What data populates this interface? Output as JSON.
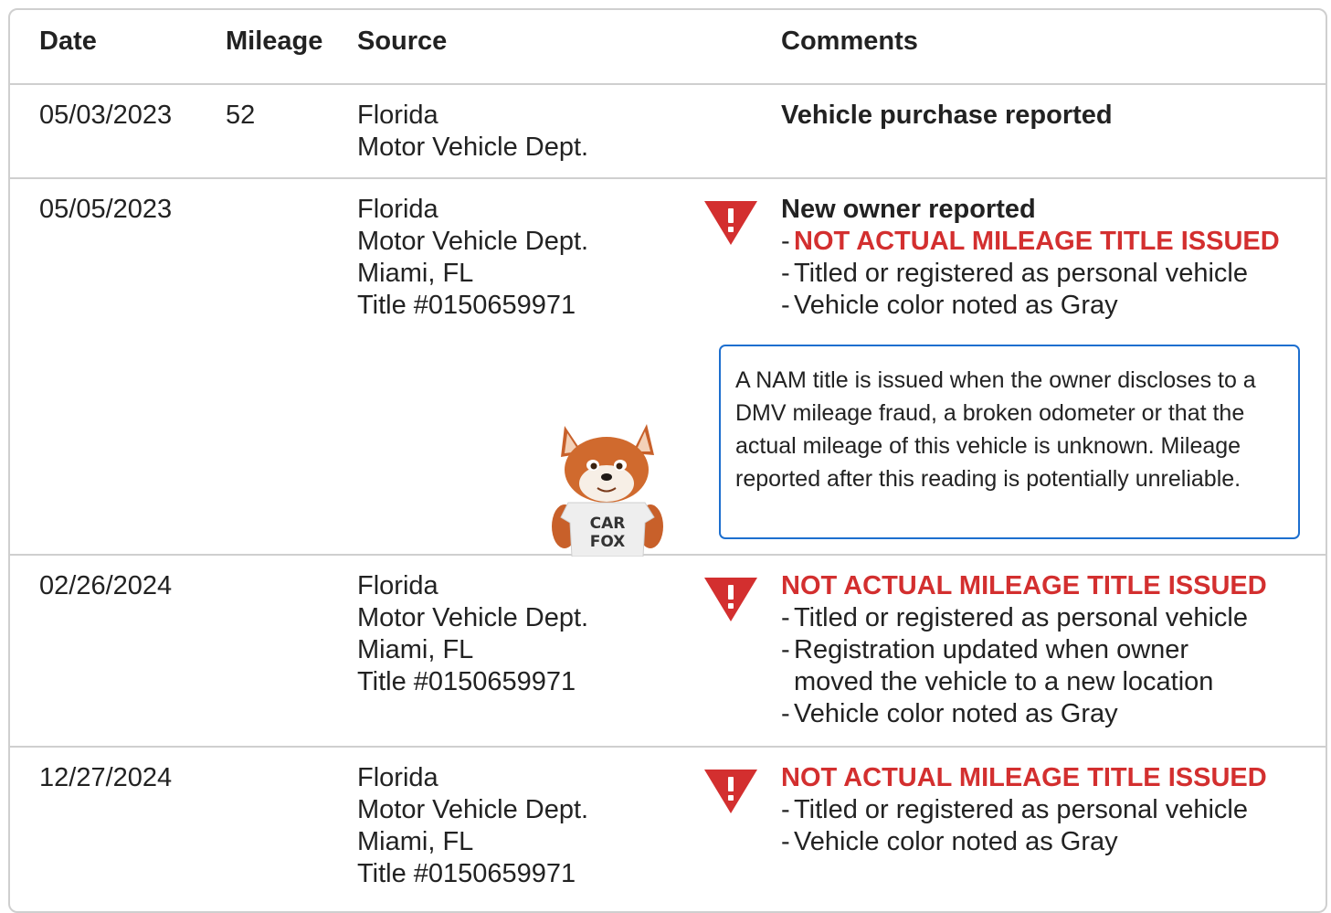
{
  "table": {
    "headers": {
      "date": "Date",
      "mileage": "Mileage",
      "source": "Source",
      "comments": "Comments"
    },
    "rows": [
      {
        "date": "05/03/2023",
        "mileage": "52",
        "source": [
          "Florida",
          "Motor Vehicle Dept."
        ],
        "comment_title": "Vehicle purchase reported"
      },
      {
        "date": "05/05/2023",
        "mileage": "",
        "source": [
          "Florida",
          "Motor Vehicle Dept.",
          "Miami, FL",
          "Title #0150659971"
        ],
        "comment_title": "New owner reported",
        "alert": "NOT ACTUAL MILEAGE TITLE ISSUED",
        "items": [
          "Titled or registered as personal vehicle",
          "Vehicle color noted as Gray"
        ],
        "note": "A NAM title is issued when the owner discloses to a DMV mileage fraud, a broken odometer or that the actual mileage of this vehicle is unknown. Mileage reported after this reading is potentially unreliable.",
        "mascot_shirt": [
          "CAR",
          "FOX"
        ]
      },
      {
        "date": "02/26/2024",
        "mileage": "",
        "source": [
          "Florida",
          "Motor Vehicle Dept.",
          "Miami, FL",
          "Title #0150659971"
        ],
        "alert": "NOT ACTUAL MILEAGE TITLE ISSUED",
        "items": [
          "Titled or registered as personal vehicle",
          "Registration updated when owner moved the vehicle to a new location",
          "Vehicle color noted as Gray"
        ]
      },
      {
        "date": "12/27/2024",
        "mileage": "",
        "source": [
          "Florida",
          "Motor Vehicle Dept.",
          "Miami, FL",
          "Title #0150659971"
        ],
        "alert": "NOT ACTUAL MILEAGE TITLE ISSUED",
        "items": [
          "Titled or registered as personal vehicle",
          "Vehicle color noted as Gray"
        ]
      }
    ],
    "dash": "-"
  },
  "icons": {
    "warning": "warning-triangle-icon",
    "mascot": "carfox-mascot"
  },
  "colors": {
    "alert": "#d32f2f",
    "note_border": "#1d6fcf",
    "divider": "#cfcfcf"
  }
}
